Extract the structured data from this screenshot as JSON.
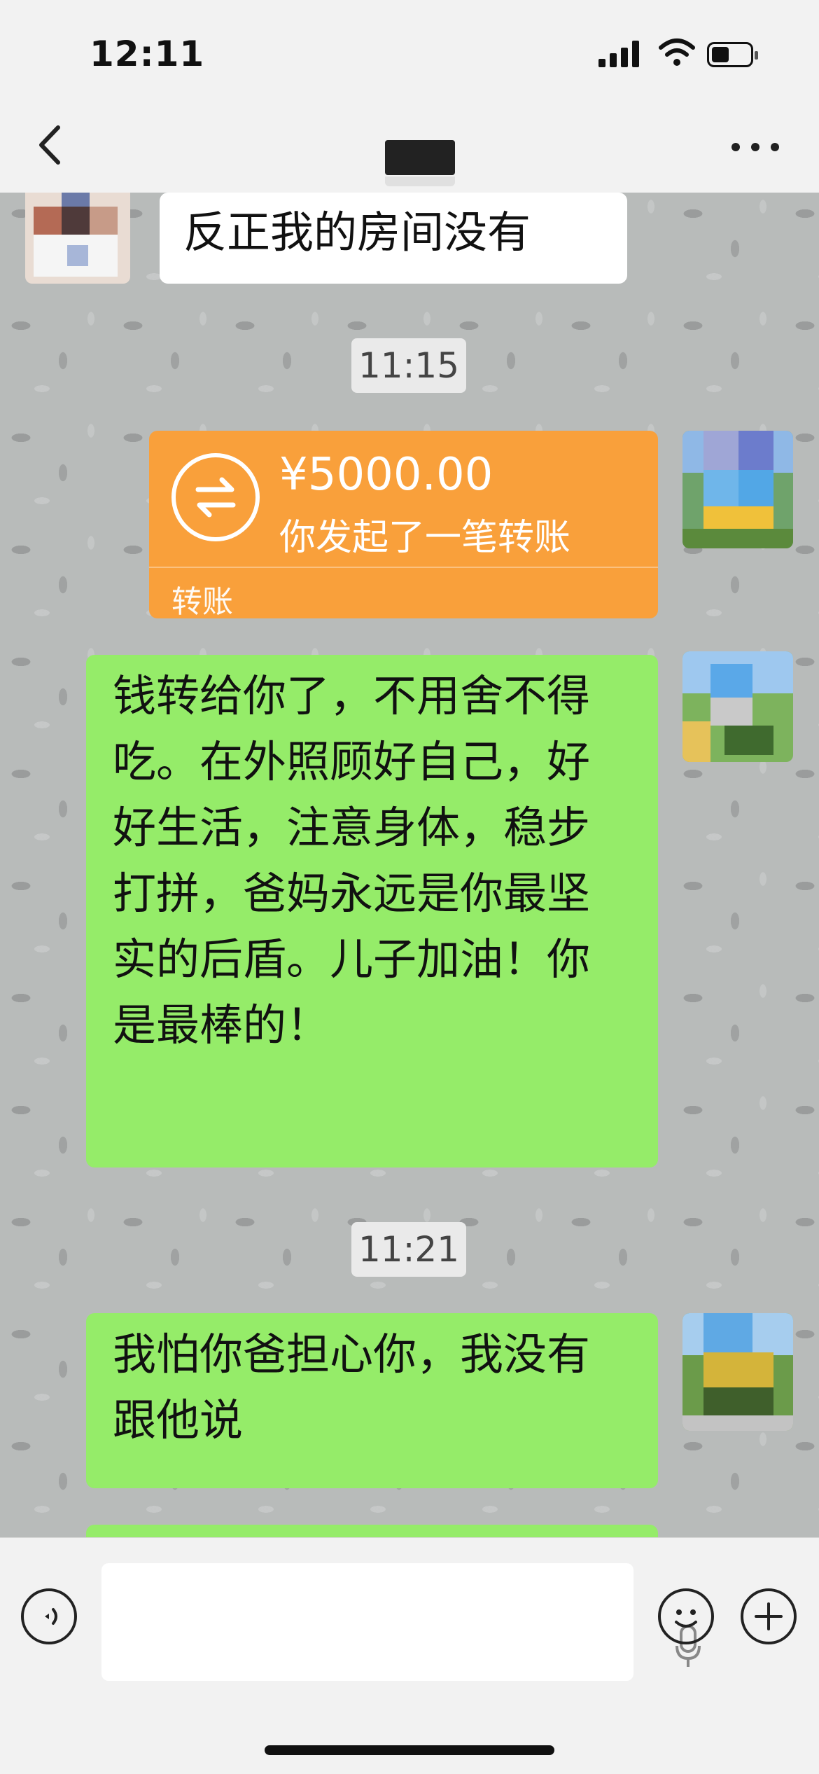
{
  "status_bar": {
    "time": "12:11"
  },
  "chat": {
    "messages": [
      {
        "sender": "other",
        "type": "text",
        "text": "反正我的房间没有"
      },
      {
        "type": "timestamp",
        "text": "11:15"
      },
      {
        "sender": "me",
        "type": "transfer",
        "amount": "¥5000.00",
        "desc": "你发起了一笔转账",
        "label": "转账"
      },
      {
        "sender": "me",
        "type": "text",
        "text": "钱转给你了，不用舍不得吃。在外照顾好自己，好好生活，注意身体，稳步打拼，爸妈永远是你最坚实的后盾。儿子加油！你是最棒的！"
      },
      {
        "type": "timestamp",
        "text": "11:21"
      },
      {
        "sender": "me",
        "type": "text",
        "text": "我怕你爸担心你，我没有跟他说"
      }
    ]
  },
  "colors": {
    "outgoing_bubble": "#95ec69",
    "incoming_bubble": "#ffffff",
    "transfer_card": "#f9a03b",
    "chat_background": "#b8bbba"
  },
  "icons": {
    "back": "chevron-left-icon",
    "more": "more-icon",
    "voice": "voice-icon",
    "mic": "mic-icon",
    "emoji": "emoji-icon",
    "plus": "plus-icon",
    "transfer": "transfer-icon"
  }
}
